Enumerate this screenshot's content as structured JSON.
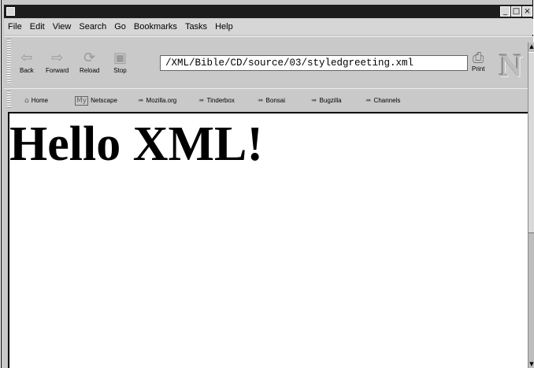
{
  "window": {
    "controls": {
      "minimize": "_",
      "maximize": "□",
      "close": "×"
    }
  },
  "menubar": {
    "items": [
      "File",
      "Edit",
      "View",
      "Search",
      "Go",
      "Bookmarks",
      "Tasks",
      "Help"
    ]
  },
  "navbar": {
    "back": "Back",
    "forward": "Forward",
    "reload": "Reload",
    "stop": "Stop",
    "url": "/XML/Bible/CD/source/03/styledgreeting.xml",
    "print": "Print",
    "logo": "N"
  },
  "bookmarks": {
    "home": "Home",
    "my_netscape_icon_text": "My",
    "netscape": "Netscape",
    "items": [
      "Mozilla.org",
      "Tinderbox",
      "Bonsai",
      "Bugzilla",
      "Channels"
    ]
  },
  "content": {
    "heading": "Hello XML!"
  },
  "colors": {
    "titlebar": "#1d1d1d",
    "chrome": "#c9c9c9",
    "content_bg": "#ffffff"
  }
}
